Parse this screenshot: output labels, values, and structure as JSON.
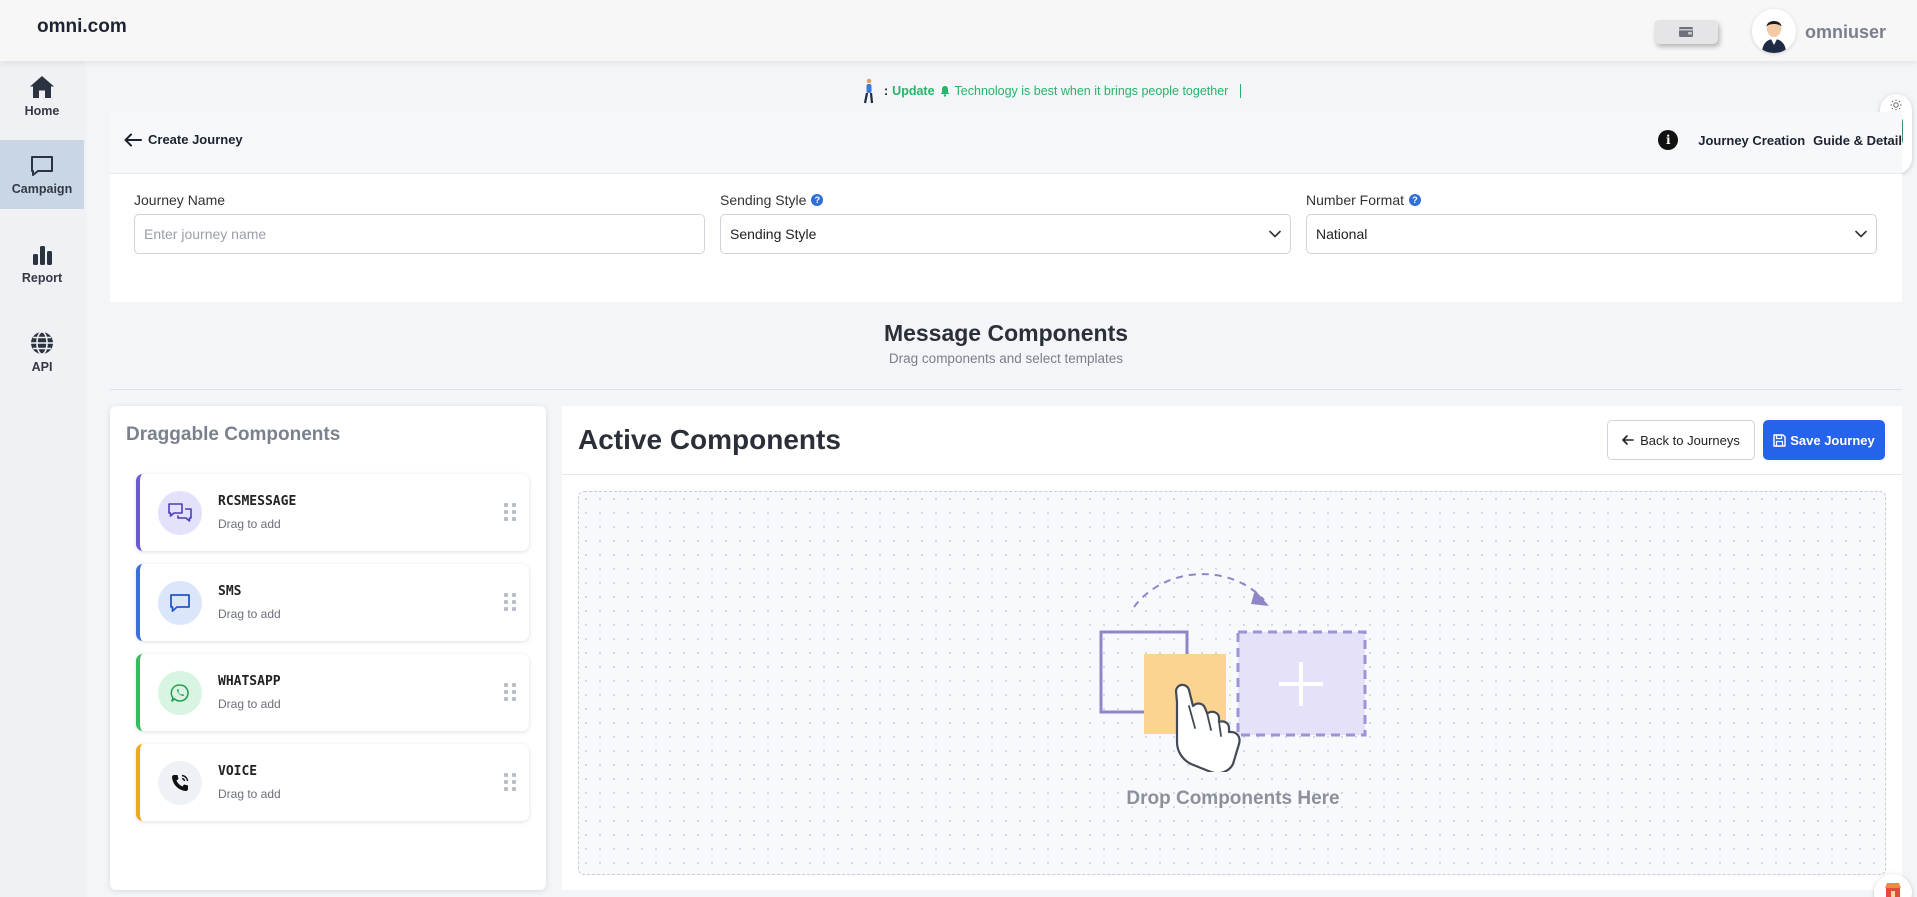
{
  "brand": "omni.com",
  "user": {
    "name": "omniuser"
  },
  "sidebar": {
    "items": [
      {
        "label": "Home",
        "icon": "home-icon"
      },
      {
        "label": "Campaign",
        "icon": "chat-icon",
        "active": true
      },
      {
        "label": "Report",
        "icon": "bar-chart-icon"
      },
      {
        "label": "API",
        "icon": "globe-icon"
      }
    ]
  },
  "ticker": {
    "prefix": ":",
    "label": "Update",
    "message": "Technology is best when it brings people together"
  },
  "header": {
    "back_label": "Create Journey",
    "guide_label_1": "Journey Creation",
    "guide_label_2": "Guide & Detail"
  },
  "form": {
    "journey_name": {
      "label": "Journey Name",
      "placeholder": "Enter journey name",
      "value": ""
    },
    "sending_style": {
      "label": "Sending Style",
      "value": "Sending Style"
    },
    "number_format": {
      "label": "Number Format",
      "value": "National"
    }
  },
  "message_components": {
    "title": "Message Components",
    "subtitle": "Drag components and select templates"
  },
  "draggable": {
    "title": "Draggable Components",
    "items": [
      {
        "name": "RCSMESSAGE",
        "desc": "Drag to add",
        "accent": "#6a5ad6",
        "icon": "chat-bubbles-icon"
      },
      {
        "name": "SMS",
        "desc": "Drag to add",
        "accent": "#3b6fe0",
        "icon": "message-square-icon"
      },
      {
        "name": "WHATSAPP",
        "desc": "Drag to add",
        "accent": "#2fbf5f",
        "icon": "whatsapp-icon"
      },
      {
        "name": "VOICE",
        "desc": "Drag to add",
        "accent": "#f0a81c",
        "icon": "phone-icon"
      }
    ]
  },
  "active": {
    "title": "Active Components",
    "back_button": "Back to Journeys",
    "save_button": "Save Journey",
    "drop_text": "Drop Components Here"
  },
  "colors": {
    "primary": "#2563eb",
    "ticker": "#28b36a",
    "sidebar_active": "#c8d6e6"
  }
}
